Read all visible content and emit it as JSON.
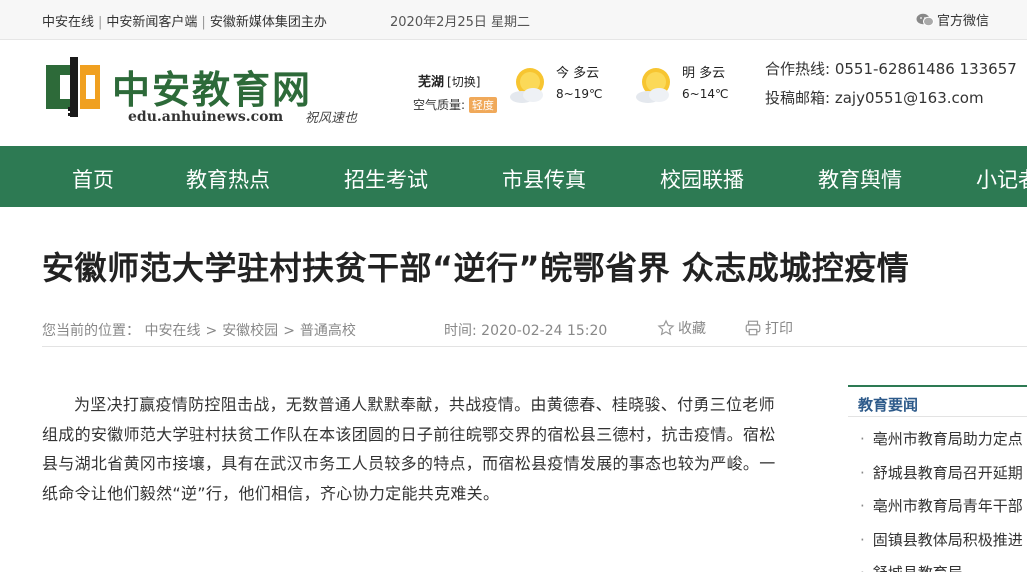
{
  "topbar": {
    "links": [
      "中安在线",
      "中安新闻客户端",
      "安徽新媒体集团主办"
    ],
    "date": "2020年2月25日 星期二",
    "wechat": "官方微信"
  },
  "header": {
    "logo_text": "中安教育网",
    "logo_url": "edu.anhuinews.com",
    "logo_sign": "祝风速也",
    "city": "芜湖",
    "city_switch": "[切换]",
    "air_quality_label": "空气质量:",
    "air_quality_value": "轻度",
    "weather": [
      {
        "day": "今 多云",
        "temp": "8~19℃",
        "icon": "sun-cloud-icon"
      },
      {
        "day": "明 多云",
        "temp": "6~14℃",
        "icon": "sun-cloud-icon"
      }
    ],
    "hotline_label": "合作热线:",
    "hotline_value": "0551-62861486 133657",
    "email_label": "投稿邮箱:",
    "email_value": "zajy0551@163.com"
  },
  "nav": [
    "首页",
    "教育热点",
    "招生考试",
    "市县传真",
    "校园联播",
    "教育舆情",
    "小记者"
  ],
  "article": {
    "title": "安徽师范大学驻村扶贫干部“逆行”皖鄂省界 众志成城控疫情",
    "breadcrumb_label": "您当前的位置：",
    "breadcrumb": [
      "中安在线",
      "安徽校园",
      "普通高校"
    ],
    "time_label": "时间:",
    "time_value": "2020-02-24 15:20",
    "favorite": "收藏",
    "print": "打印",
    "paragraph": "为坚决打赢疫情防控阻击战，无数普通人默默奉献，共战疫情。由黄德春、桂晓骏、付勇三位老师组成的安徽师范大学驻村扶贫工作队在本该团圆的日子前往皖鄂交界的宿松县三德村，抗击疫情。宿松县与湖北省黄冈市接壤，具有在武汉市务工人员较多的特点，而宿松县疫情发展的事态也较为严峻。一纸命令让他们毅然“逆”行，他们相信，齐心协力定能共克难关。"
  },
  "sidebar": {
    "heading": "教育要闻",
    "items": [
      "亳州市教育局助力定点",
      "舒城县教育局召开延期",
      "亳州市教育局青年干部",
      "固镇县教体局积极推进",
      "舒城县教育局"
    ]
  },
  "colors": {
    "nav_bg": "#2d7a53",
    "logo_green": "#2d6a39",
    "aq_badge": "#f0a95a",
    "side_heading": "#2d5a8a"
  }
}
